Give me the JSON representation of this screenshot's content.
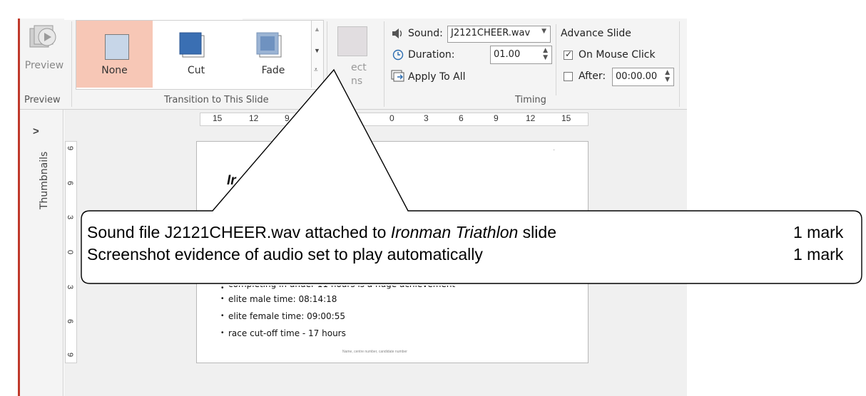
{
  "ribbon": {
    "preview_group": {
      "button_label": "Preview",
      "group_label": "Preview"
    },
    "transitions": {
      "items": [
        {
          "label": "None",
          "selected": true
        },
        {
          "label": "Cut",
          "selected": false
        },
        {
          "label": "Fade",
          "selected": false
        }
      ],
      "group_label": "Transition to This Slide"
    },
    "effect_options": {
      "label_line1": "ect",
      "label_line2": "ns"
    },
    "timing": {
      "sound_label": "Sound:",
      "sound_value": "J2121CHEER.wav",
      "duration_label": "Duration:",
      "duration_value": "01.00",
      "apply_all_label": "Apply To All",
      "advance_title": "Advance Slide",
      "on_mouse_click_label": "On Mouse Click",
      "on_mouse_click_checked": true,
      "after_label": "After:",
      "after_value": "00:00.00",
      "group_label": "Timing"
    }
  },
  "side": {
    "expand_glyph": ">",
    "thumbnails_label": "Thumbnails"
  },
  "ruler": {
    "h_left": [
      "15",
      "12",
      "9"
    ],
    "h_right": [
      "0",
      "3",
      "6",
      "9",
      "12",
      "15"
    ],
    "v": [
      "9",
      "6",
      "3",
      "0",
      "3",
      "6",
      "9"
    ]
  },
  "slide": {
    "title_fragment": "Ir",
    "bullets": [
      "completing in under 11 hours is a huge achievement",
      "elite male time: 08:14:18",
      "elite female time: 09:00:55",
      "race cut-off time - 17 hours"
    ],
    "footer": "Name, centre number, candidate number",
    "corner_mark": "·"
  },
  "callout": {
    "line1_prefix": "Sound file J2121CHEER.wav attached to ",
    "line1_italic": "Ironman Triathlon",
    "line1_suffix": " slide",
    "line1_mark": "1 mark",
    "line2_text": "Screenshot evidence of audio set to play automatically",
    "line2_mark": "1 mark"
  }
}
